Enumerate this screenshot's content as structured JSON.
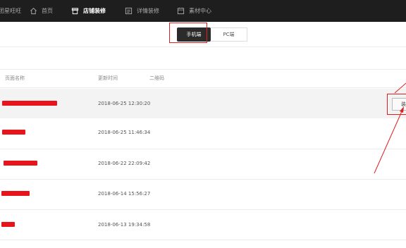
{
  "nav": {
    "items": [
      {
        "label": "团星旺旺",
        "icon": "logo-icon",
        "active": false
      },
      {
        "label": "首页",
        "icon": "home-icon",
        "active": false
      },
      {
        "label": "店铺装修",
        "icon": "store-icon",
        "active": true
      },
      {
        "label": "详情装修",
        "icon": "detail-icon",
        "active": false
      },
      {
        "label": "素材中心",
        "icon": "folder-icon",
        "active": false
      }
    ]
  },
  "device_toggle": {
    "mobile_label": "手机端",
    "pc_label": "PC端",
    "selected": "mobile"
  },
  "table": {
    "headers": {
      "name": "页面名称",
      "updated": "更新时间",
      "qrcode": "二维码"
    },
    "rows": [
      {
        "name": "[redacted]",
        "updated": "2018-06-25 12:30:20"
      },
      {
        "name": "[redacted]",
        "updated": "2018-06-25 11:46:34"
      },
      {
        "name": "[redacted]",
        "updated": "2018-06-22 22:09:42"
      },
      {
        "name": "[redacted]",
        "updated": "2018-06-14 15:56:27"
      },
      {
        "name": "[redacted]",
        "updated": "2018-06-13 19:34:58"
      }
    ],
    "action_label": "装"
  },
  "colors": {
    "annotation": "#e02020",
    "topbar": "#1e1e1e",
    "redaction": "#e8141b"
  }
}
